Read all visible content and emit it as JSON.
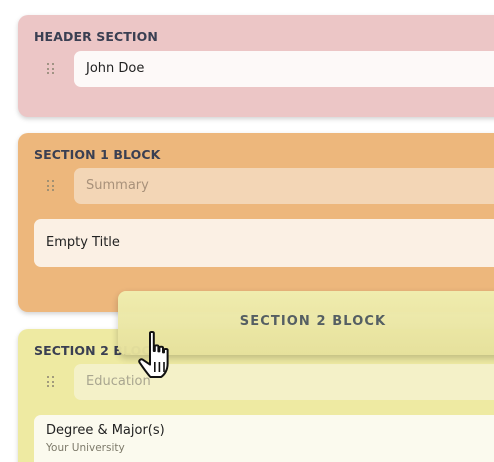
{
  "header_block": {
    "title": "HEADER SECTION",
    "name_value": "John Doe"
  },
  "section1_block": {
    "title": "SECTION 1 BLOCK",
    "heading_placeholder": "Summary",
    "item_title": "Empty Title"
  },
  "section2_block": {
    "title": "SECTION 2 BLOCK",
    "heading_placeholder": "Education",
    "item_title": "Degree & Major(s)",
    "item_subtitle": "Your University"
  },
  "dragged_block": {
    "label": "SECTION 2 BLOCK"
  },
  "icons": {
    "drag_handle": "drag-handle-icon",
    "cursor": "hand-pointer-cursor-icon"
  },
  "colors": {
    "header_bg": "#ecc6c6",
    "section1_bg": "#edb77c",
    "section2_bg": "#eeeaa2",
    "title_text": "#3a3f52"
  }
}
